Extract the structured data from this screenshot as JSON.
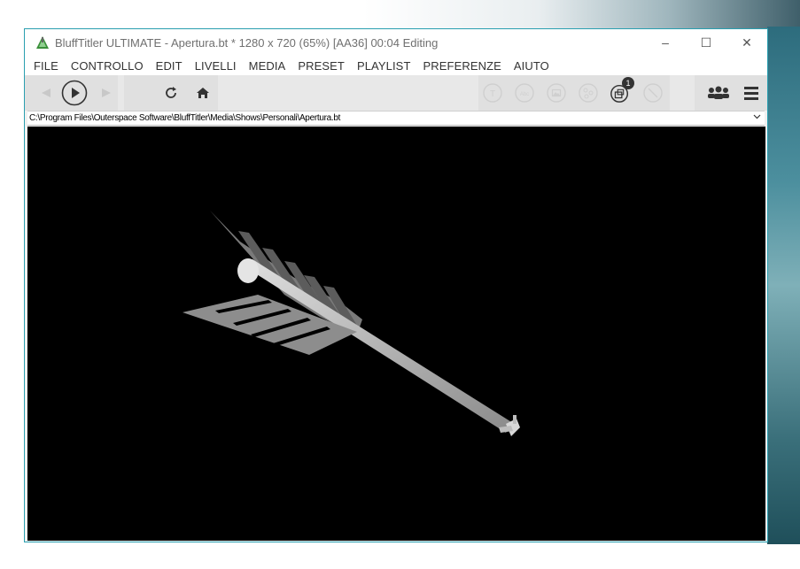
{
  "window": {
    "title": "BluffTitler ULTIMATE  - Apertura.bt * 1280 x 720 (65%) [AA36] 00:04 Editing",
    "minimize": "–",
    "maximize": "☐",
    "close": "✕"
  },
  "menu": {
    "items": [
      "FILE",
      "CONTROLLO",
      "EDIT",
      "LIVELLI",
      "MEDIA",
      "PRESET",
      "PLAYLIST",
      "PREFERENZE",
      "AIUTO"
    ]
  },
  "toolbar": {
    "layers_badge": "1"
  },
  "path": {
    "value": "C:\\Program Files\\Outerspace Software\\BluffTitler\\Media\\Shows\\Personali\\Apertura.bt",
    "dropdown_icon": "chevron-down-icon"
  },
  "colors": {
    "accent_border": "#2a9fb0",
    "viewport_bg": "#000000"
  }
}
